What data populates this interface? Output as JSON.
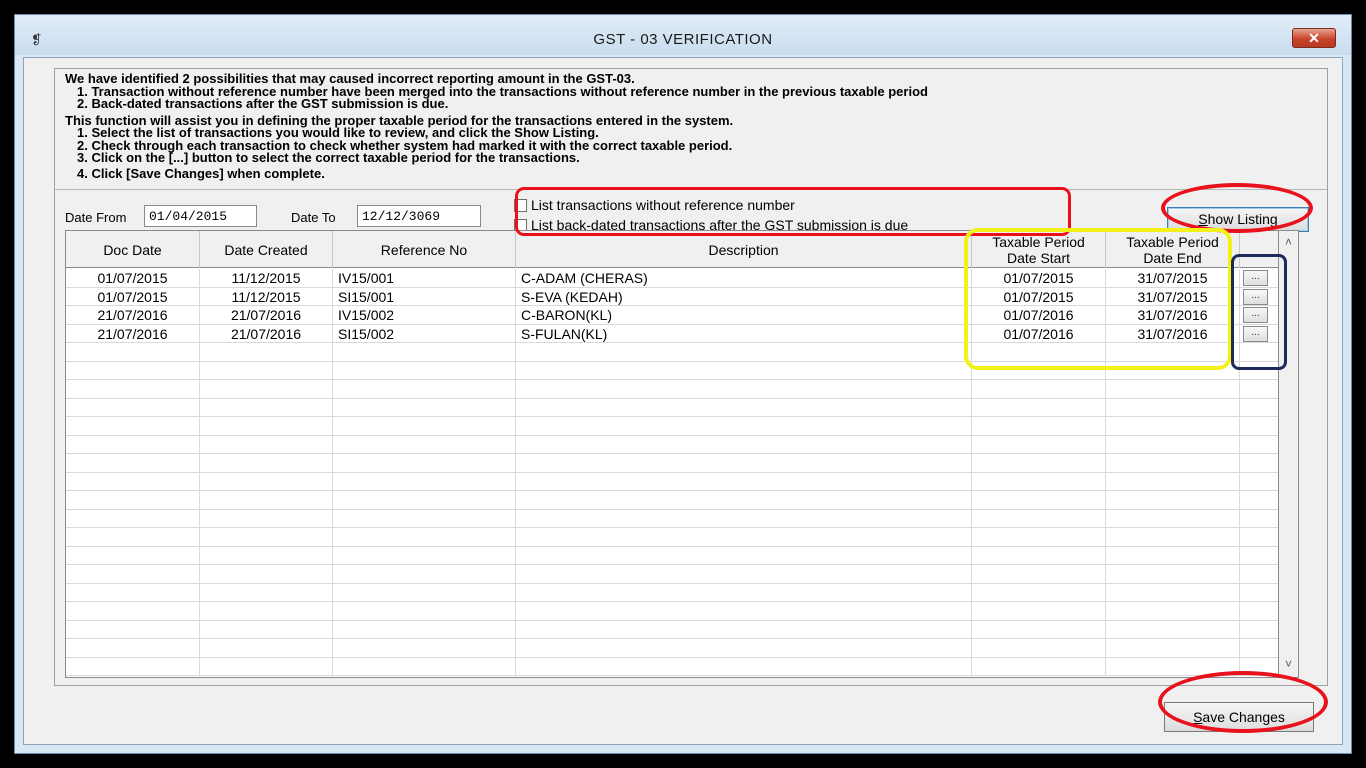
{
  "window": {
    "title": "GST - 03 VERIFICATION",
    "sys_icon": "❡",
    "close_label": "✕"
  },
  "intro": {
    "line1": "We have identified 2 possibilities that may caused incorrect reporting amount in the GST-03.",
    "line2": "1. Transaction without reference number have been merged into the transactions without reference number in the previous taxable period",
    "line3": "2. Back-dated transactions after the GST submission is due.",
    "line4": "This function will assist you in defining the proper taxable period for the transactions entered in the system.",
    "line5": "1. Select the list of transactions you would like to review, and click the Show Listing.",
    "line6": "2. Check through each transaction to check whether system had marked it with the correct taxable period.",
    "line7": "3. Click on the [...] button to select the correct taxable period for the transactions.",
    "line8": "4. Click [Save Changes] when complete."
  },
  "filters": {
    "date_from_label": "Date From",
    "date_from_value": "01/04/2015",
    "date_to_label": "Date To",
    "date_to_value": "12/12/3069",
    "option1_label": "List transactions without reference number",
    "option2_label": "List back-dated transactions after the GST submission is due",
    "show_listing_label": "Show Listing"
  },
  "grid": {
    "headers": {
      "doc_date": "Doc Date",
      "date_created": "Date Created",
      "reference_no": "Reference No",
      "description": "Description",
      "tp_start_1": "Taxable Period",
      "tp_start_2": "Date Start",
      "tp_end_1": "Taxable Period",
      "tp_end_2": "Date End"
    },
    "ellipsis_label": "...",
    "rows": [
      {
        "doc_date": "01/07/2015",
        "date_created": "11/12/2015",
        "reference_no": "IV15/001",
        "description": "C-ADAM (CHERAS)",
        "start": "01/07/2015",
        "end": "31/07/2015"
      },
      {
        "doc_date": "01/07/2015",
        "date_created": "11/12/2015",
        "reference_no": "SI15/001",
        "description": "S-EVA (KEDAH)",
        "start": "01/07/2015",
        "end": "31/07/2015"
      },
      {
        "doc_date": "21/07/2016",
        "date_created": "21/07/2016",
        "reference_no": "IV15/002",
        "description": "C-BARON(KL)",
        "start": "01/07/2016",
        "end": "31/07/2016"
      },
      {
        "doc_date": "21/07/2016",
        "date_created": "21/07/2016",
        "reference_no": "SI15/002",
        "description": "S-FULAN(KL)",
        "start": "01/07/2016",
        "end": "31/07/2016"
      }
    ],
    "scroll_up": "˄",
    "scroll_down": "˅"
  },
  "footer": {
    "save_label": "Save Changes"
  },
  "colors": {
    "annotation_red": "#e8111c",
    "annotation_yellow": "#f4f01a",
    "annotation_navy": "#1c2a5c"
  }
}
